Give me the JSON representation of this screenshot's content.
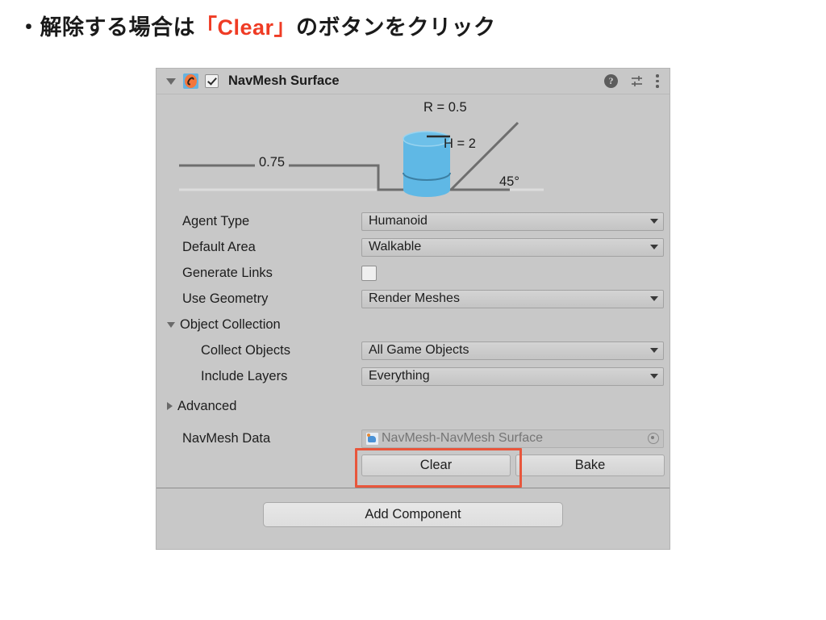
{
  "slide": {
    "heading_prefix": "・解除する場合は",
    "heading_accent": "「Clear」",
    "heading_suffix": "のボタンをクリック",
    "accent_color": "#ef3b24"
  },
  "inspector": {
    "component_title": "NavMesh Surface",
    "enabled_checkbox": true,
    "expanded": true,
    "header_icons": {
      "help": "?",
      "preset": "preset-icon",
      "menu": "kebab-icon"
    },
    "agent_diagram": {
      "step_height_label": "0.75",
      "radius_label": "R = 0.5",
      "height_label": "H = 2",
      "slope_label": "45°",
      "agent_color": "#5fb8e5"
    },
    "rows": [
      {
        "label": "Agent Type",
        "type": "dropdown",
        "value": "Humanoid"
      },
      {
        "label": "Default Area",
        "type": "dropdown",
        "value": "Walkable"
      },
      {
        "label": "Generate Links",
        "type": "checkbox",
        "value": false
      },
      {
        "label": "Use Geometry",
        "type": "dropdown",
        "value": "Render Meshes"
      }
    ],
    "object_collection": {
      "label": "Object Collection",
      "expanded": true,
      "rows": [
        {
          "label": "Collect Objects",
          "type": "dropdown",
          "value": "All Game Objects"
        },
        {
          "label": "Include Layers",
          "type": "dropdown",
          "value": "Everything"
        }
      ]
    },
    "advanced": {
      "label": "Advanced",
      "expanded": false
    },
    "navmesh_data": {
      "label": "NavMesh Data",
      "value": "NavMesh-NavMesh Surface"
    },
    "buttons": {
      "clear": "Clear",
      "bake": "Bake",
      "highlighted": "Clear",
      "highlight_color": "#e8563c"
    },
    "add_component": "Add Component"
  }
}
